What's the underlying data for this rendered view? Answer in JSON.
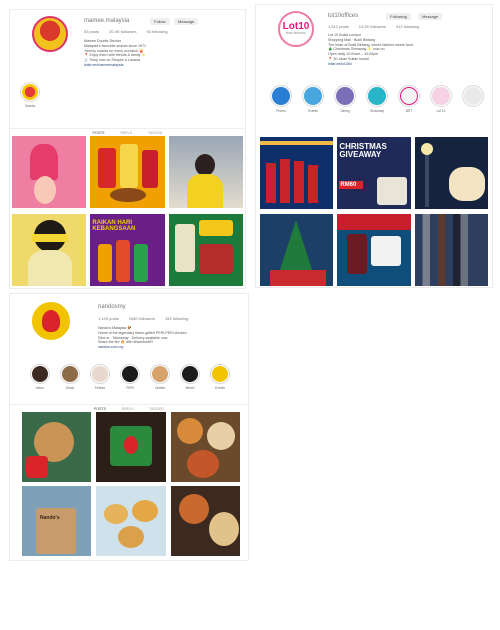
{
  "panel1": {
    "username": "mamee.malaysia",
    "follow_label": "Follow",
    "message_label": "Message",
    "stats": [
      "53 posts",
      "20.4K followers",
      "93 following"
    ],
    "bio": [
      "Mamee Double-Decker",
      "Malaysia's favourite snacks since 1971",
      "Yummy snacks for every occasion 🍟",
      "📍 Enjoy them with friends & family ✨",
      "🛒 Shop now on Shopee & Lazada"
    ],
    "link": "linktr.ee/mameemalaysia",
    "highlight_label": "Snacks",
    "tabs": [
      "POSTS",
      "REELS",
      "TAGGED"
    ]
  },
  "panel2": {
    "logo_text": "Lot10",
    "logo_sub": "BUKIT BINTANG",
    "username": "lot10offices",
    "follow_label": "Following",
    "message_label": "Message",
    "stats": [
      "1,512 posts",
      "13.2K followers",
      "512 following"
    ],
    "bio": [
      "Lot 10 Kuala Lumpur",
      "Shopping Mall · Bukit Bintang",
      "The heart of Bukit Bintang, where fashion meets food",
      "🎄 Christmas Giveaway ✨ now on",
      "Open daily 10:00am – 10:00pm",
      "📍 50 Jalan Sultan Ismail"
    ],
    "link": "linktr.ee/lot10kl",
    "highlights": [
      "Promo",
      "Events",
      "Dining",
      "Giveaway",
      "BRT",
      "Lot 10"
    ],
    "tiles": {
      "t2_title": "CHRISTMAS GIVEAWAY",
      "t2_price": "RM60"
    }
  },
  "panel3": {
    "username": "nandosmy",
    "stats": [
      "1,129 posts",
      "106K followers",
      "153 following"
    ],
    "bio": [
      "Nando's Malaysia 🐓",
      "Home of the legendary flame-grilled PERi-PERi chicken",
      "Dine-in · Takeaway · Delivery available now",
      "Share the fire 🔥 with #NandosMY"
    ],
    "link": "nandos.com.my",
    "highlights": [
      "Menu",
      "Deals",
      "Festive",
      "PERi",
      "Outlets",
      "Merch",
      "Events"
    ],
    "tabs": [
      "POSTS",
      "REELS",
      "TAGGED"
    ],
    "tiles": {
      "t4_box": "Nando's"
    }
  },
  "tile_captions_p1": {
    "t5": "RAIKAN HARI KEBANGSAAN"
  },
  "colors": {
    "panel_bg": "#ffffff",
    "border": "#ececec",
    "accent_red": "#d9242a",
    "mamee_yellow": "#f6c400",
    "lot10_pink": "#e2157a"
  }
}
